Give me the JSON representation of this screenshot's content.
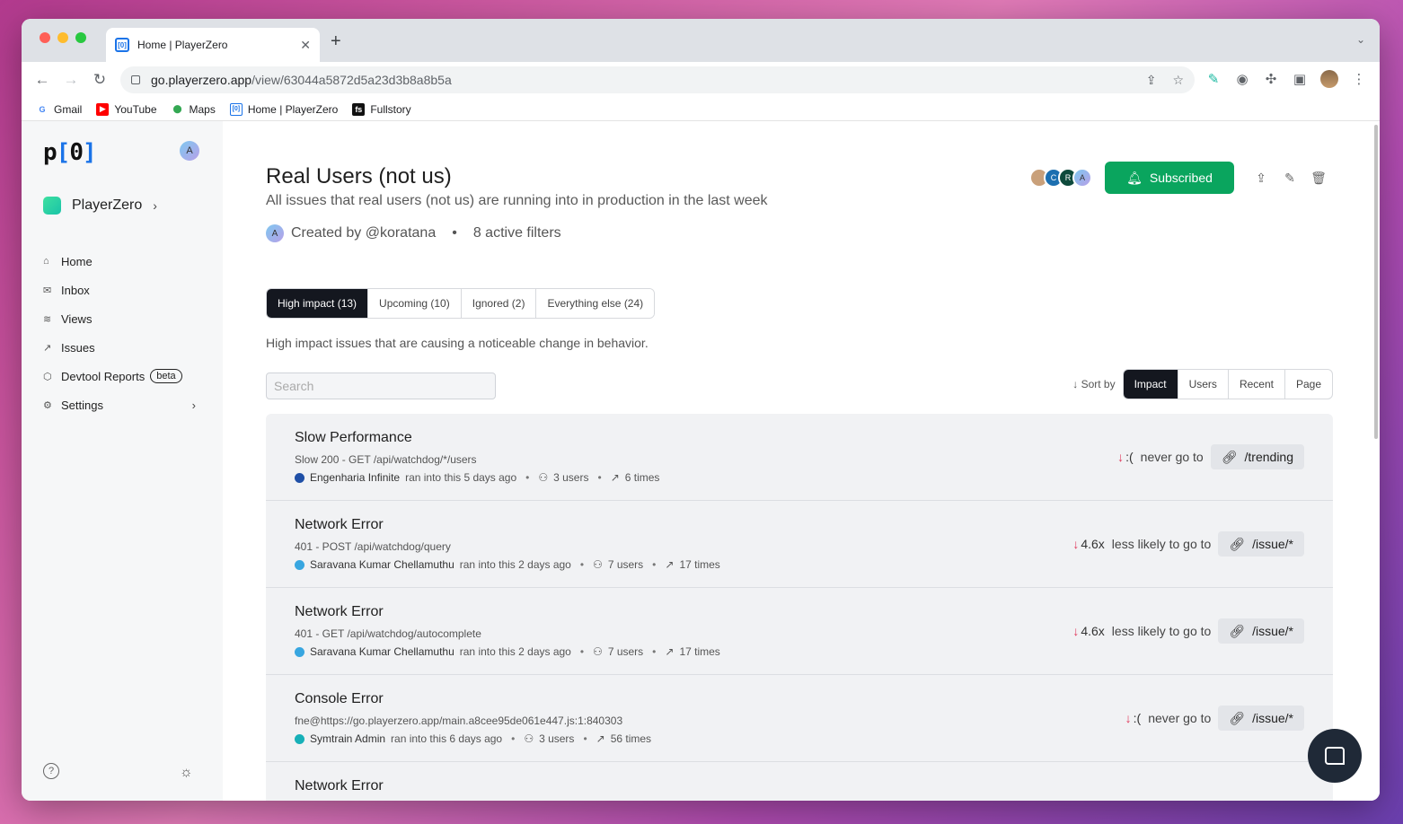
{
  "browser": {
    "tab_title": "Home | PlayerZero",
    "tab_favicon": "[0]",
    "url_host": "go.playerzero.app",
    "url_path": "/view/63044a5872d5a23d3b8a8b5a",
    "bookmarks": [
      {
        "label": "Gmail",
        "icon": "G"
      },
      {
        "label": "YouTube",
        "icon": "▶"
      },
      {
        "label": "Maps",
        "icon": "⬤"
      },
      {
        "label": "Home | PlayerZero",
        "icon": "[0]"
      },
      {
        "label": "Fullstory",
        "icon": "fs"
      }
    ]
  },
  "sidebar": {
    "logo": {
      "p": "p",
      "open": "[",
      "zero": "0",
      "close": "]"
    },
    "user_initial": "A",
    "workspace": "PlayerZero",
    "items": [
      {
        "label": "Home",
        "icon": "⌂"
      },
      {
        "label": "Inbox",
        "icon": "✉"
      },
      {
        "label": "Views",
        "icon": "≋"
      },
      {
        "label": "Issues",
        "icon": "↗"
      },
      {
        "label": "Devtool Reports",
        "icon": "⬡",
        "badge": "beta"
      },
      {
        "label": "Settings",
        "icon": "⚙"
      }
    ]
  },
  "view": {
    "title": "Real Users (not us)",
    "description": "All issues that real users (not us) are running into in production in the last week",
    "creator_initial": "A",
    "created_by": "Created by @koratana",
    "filters": "8 active filters",
    "subscriber_initials": [
      "",
      "C",
      "R",
      "A"
    ],
    "subscribe_label": "Subscribed"
  },
  "tabs": [
    {
      "label": "High impact (13)",
      "active": true
    },
    {
      "label": "Upcoming (10)",
      "active": false
    },
    {
      "label": "Ignored (2)",
      "active": false
    },
    {
      "label": "Everything else (24)",
      "active": false
    }
  ],
  "tab_description": "High impact issues that are causing a noticeable change in behavior.",
  "search": {
    "placeholder": "Search",
    "value": ""
  },
  "sort": {
    "label": "Sort by",
    "options": [
      "Impact",
      "Users",
      "Recent",
      "Page"
    ],
    "active": "Impact"
  },
  "issues": [
    {
      "title": "Slow Performance",
      "subtitle": "Slow 200 - GET /api/watchdog/*/users",
      "org": "Engenharia Infinite",
      "org_color": "#1f4fa6",
      "ran": "ran into this 5 days ago",
      "users": "3 users",
      "times": "6 times",
      "impact_value": ":(",
      "impact_text": "never go to",
      "page": "/trending"
    },
    {
      "title": "Network Error",
      "subtitle": "401 - POST /api/watchdog/query",
      "org": "Saravana Kumar Chellamuthu",
      "org_color": "#38a6e0",
      "ran": "ran into this 2 days ago",
      "users": "7 users",
      "times": "17 times",
      "impact_value": "4.6x",
      "impact_text": "less likely to go to",
      "page": "/issue/*"
    },
    {
      "title": "Network Error",
      "subtitle": "401 - GET /api/watchdog/autocomplete",
      "org": "Saravana Kumar Chellamuthu",
      "org_color": "#38a6e0",
      "ran": "ran into this 2 days ago",
      "users": "7 users",
      "times": "17 times",
      "impact_value": "4.6x",
      "impact_text": "less likely to go to",
      "page": "/issue/*"
    },
    {
      "title": "Console Error",
      "subtitle": "fne@https://go.playerzero.app/main.a8cee95de061e447.js:1:840303",
      "org": "Symtrain Admin",
      "org_color": "#17b0b8",
      "ran": "ran into this 6 days ago",
      "users": "3 users",
      "times": "56 times",
      "impact_value": ":(",
      "impact_text": "never go to",
      "page": "/issue/*"
    },
    {
      "title": "Network Error",
      "subtitle": "",
      "org": "",
      "org_color": "#38a6e0",
      "ran": "",
      "users": "",
      "times": "",
      "impact_value": "",
      "impact_text": "",
      "page": ""
    }
  ],
  "colors": {
    "accent": "#0aa55e",
    "dark": "#14171f",
    "impact_arrow": "#e0385a"
  }
}
